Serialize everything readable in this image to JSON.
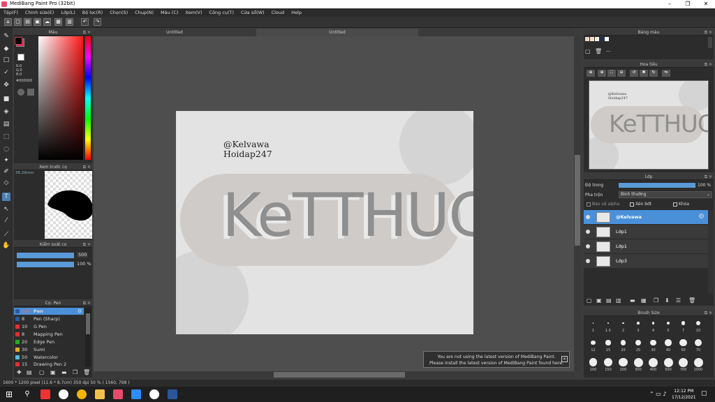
{
  "window": {
    "title": "MediBang Paint Pro (32bit)",
    "minimize": "–",
    "maximize": "❐",
    "close": "✕"
  },
  "menu": [
    "Tệp(F)",
    "Chỉnh sửa(E)",
    "Lớp(L)",
    "Bộ lọc(R)",
    "Chọn(S)",
    "Chụp(N)",
    "Màu (C)",
    "Xem(V)",
    "Công cụ(T)",
    "Cửa sổ(W)",
    "Cloud",
    "Help"
  ],
  "tabs": [
    "Untitled",
    "Untitled"
  ],
  "color_panel": {
    "title": "Màu",
    "r": "R:0",
    "g": "G:0",
    "b": "B:0",
    "hex": "#000000"
  },
  "preview_panel": {
    "title": "Xem trước cọ",
    "size": "36.29mm"
  },
  "brush_control": {
    "title": "Kiểm soát cọ",
    "size": "500",
    "opacity": "100 %"
  },
  "brush_panel": {
    "title": "Cọ: Pen",
    "items": [
      {
        "size": "160",
        "name": "Pen",
        "color": "#2a5aa0"
      },
      {
        "size": "8",
        "name": "Pen (Sharp)",
        "color": "#2a5aa0"
      },
      {
        "size": "10",
        "name": "G Pen",
        "color": "#d33"
      },
      {
        "size": "8",
        "name": "Mapping Pen",
        "color": "#d33"
      },
      {
        "size": "20",
        "name": "Edge Pen",
        "color": "#2a2"
      },
      {
        "size": "30",
        "name": "Sumi",
        "color": "#da3"
      },
      {
        "size": "50",
        "name": "Watercolor",
        "color": "#5bd"
      },
      {
        "size": "15",
        "name": "Drawing Pen 2",
        "color": "#d33"
      }
    ]
  },
  "artwork": {
    "handle": "@Kelvawa",
    "site": "Hoidap247",
    "word": "KeTTHUC"
  },
  "palette_panel": {
    "title": "Bảng màu",
    "dash": "---"
  },
  "navigator_panel": {
    "title": "Hoa tiêu"
  },
  "layer_panel": {
    "title": "Lớp",
    "opacity_label": "Độ trong",
    "opacity_value": "100 %",
    "blend_label": "Pha trộn",
    "blend_value": "Bình thường",
    "protect_alpha": "Bảo vệ alpha",
    "clipping": "Xén bớt",
    "lock": "Khóa",
    "layers": [
      "@Kelvawa",
      "Lớp1",
      "Lớp1",
      "Lớp3"
    ]
  },
  "brush_size_panel": {
    "title": "Brush Size",
    "sizes": [
      "1",
      "1.5",
      "2",
      "3",
      "4",
      "5",
      "7",
      "10",
      "12",
      "15",
      "20",
      "25",
      "30",
      "40",
      "50",
      "70",
      "100",
      "150",
      "200",
      "300",
      "400",
      "500",
      "700",
      "1000"
    ]
  },
  "notification": {
    "line1": "You are not using the latest version of MediBang Paint.",
    "line2": "Please install the latest version of MediBang Paint found here."
  },
  "status": "1600 * 1200 pixel  (11.6 * 8.7cm)  350 dpi  50 %  ( 1560, 798 )",
  "taskbar": {
    "time": "12:12 PM",
    "date": "17/12/2021"
  }
}
